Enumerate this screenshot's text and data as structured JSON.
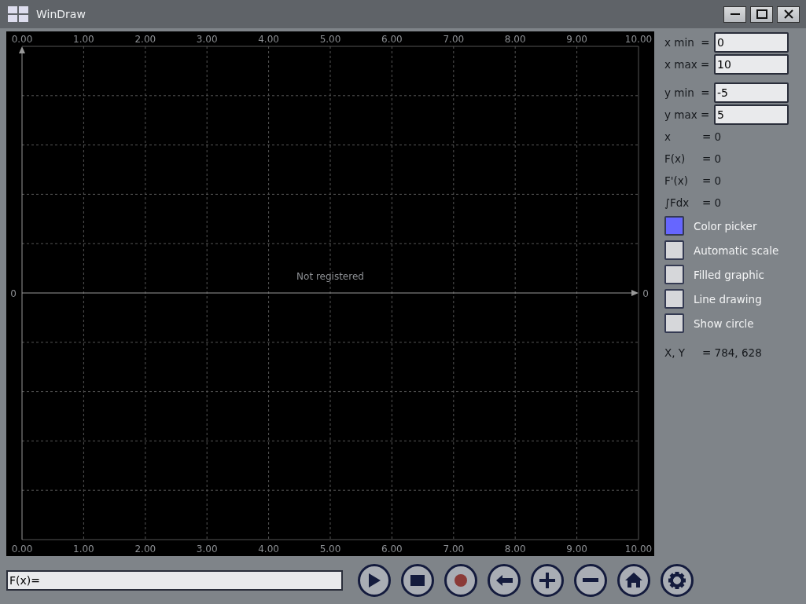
{
  "window": {
    "title": "WinDraw"
  },
  "plot": {
    "top_labels": [
      "0.00",
      "1.00",
      "2.00",
      "3.00",
      "4.00",
      "5.00",
      "6.00",
      "7.00",
      "8.00",
      "9.00",
      "10.00"
    ],
    "left_label": "0",
    "notice": "Not registered",
    "right_label": "0",
    "bottom_labels": [
      "0.00",
      "1.00",
      "2.00",
      "3.00",
      "4.00",
      "5.00",
      "6.00",
      "7.00",
      "8.00",
      "9.00",
      "10.00"
    ]
  },
  "ranges": [
    {
      "label": "x min  =",
      "value": "0"
    },
    {
      "label": "x max =",
      "value": "10"
    },
    {
      "label": "y min  =",
      "value": "-5"
    },
    {
      "label": "y max =",
      "value": "5"
    }
  ],
  "readouts": [
    {
      "label": "x",
      "value": "= 0"
    },
    {
      "label": "F(x)",
      "value": "= 0"
    },
    {
      "label": "F'(x)",
      "value": "= 0"
    },
    {
      "label": "∫Fdx",
      "value": "= 0"
    }
  ],
  "options": [
    {
      "kind": "color",
      "label": "Color picker",
      "color": "#6666ff"
    },
    {
      "kind": "checkbox",
      "label": "Automatic scale",
      "checked": false
    },
    {
      "kind": "checkbox",
      "label": "Filled graphic",
      "checked": false
    },
    {
      "kind": "checkbox",
      "label": "Line drawing",
      "checked": false
    },
    {
      "kind": "checkbox",
      "label": "Show circle",
      "checked": false
    }
  ],
  "cursor": {
    "label": "X, Y",
    "value": "= 784, 628"
  },
  "formula": {
    "value": "F(x)="
  },
  "toolbar": [
    {
      "kind": "play"
    },
    {
      "kind": "stop"
    },
    {
      "kind": "record"
    },
    {
      "kind": "back"
    },
    {
      "kind": "plus"
    },
    {
      "kind": "minus"
    },
    {
      "kind": "home"
    },
    {
      "kind": "settings"
    }
  ]
}
